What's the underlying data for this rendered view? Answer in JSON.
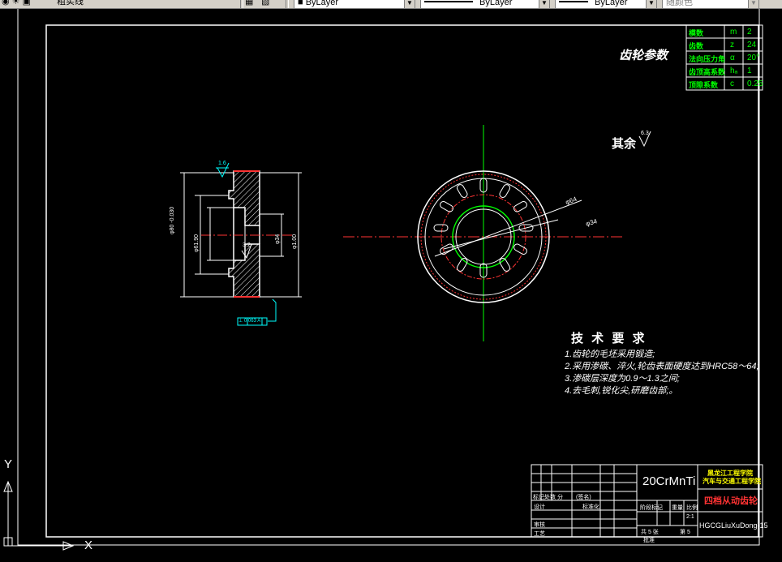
{
  "toolbar": {
    "layer_name": "粗实线",
    "color_value": "ByLayer",
    "linetype_value": "ByLayer",
    "lineweight_value": "ByLayer",
    "plotstyle_value": "随颜色"
  },
  "param_table": {
    "heading": "齿轮参数",
    "rows": [
      {
        "name": "模数",
        "symbol": "m",
        "value": "2"
      },
      {
        "name": "齿数",
        "symbol": "z",
        "value": "24"
      },
      {
        "name": "法向压力角",
        "symbol": "α",
        "value": "20°"
      },
      {
        "name": "齿顶高系数",
        "symbol": "hₐ",
        "value": "1"
      },
      {
        "name": "顶隙系数",
        "symbol": "c",
        "value": "0.25"
      }
    ]
  },
  "roughness_note": {
    "label": "其余",
    "value": "6.3"
  },
  "section_view": {
    "roughness_top": "1.6",
    "roughness_mid": "3.2",
    "dim_outer_left": "φ80 -0.030",
    "dim_inner_left": "φ61.90",
    "dim_bore": "φ34",
    "dim_od": "φ1.00",
    "tolerance_frame": "⊥ 0.063 A"
  },
  "front_view": {
    "dim_64": "φ64",
    "dim_34": "φ34"
  },
  "tech_req": {
    "title": "技 术 要 求",
    "items": [
      "1.齿轮的毛坯采用锻造;",
      "2.采用渗碳、淬火,轮齿表面硬度达到HRC58～64;",
      "3.渗碳层深度为0.9～1.3之间;",
      "4.去毛刺,锐化尖,研磨齿部;。"
    ]
  },
  "title_block": {
    "material": "20CrMnTi",
    "school_line1": "黑龙江工程学院",
    "school_line2": "汽车与交通工程学院",
    "part_name": "四档从动齿轮",
    "drawing_no": "HGCGLiuXuDong-15",
    "scale": "2:1",
    "sheets_total": "共 5 张",
    "sheet_no": "第 5",
    "lbl_mark_zone": "标记处数 分",
    "lbl_signature": "(签名)",
    "lbl_design": "设计",
    "lbl_standard": "标准化",
    "lbl_review": "审核",
    "lbl_process": "工艺",
    "lbl_stage": "阶段标记",
    "lbl_weight": "重量",
    "lbl_scale": "比例",
    "lbl_approve": "批准"
  },
  "ucs": {
    "x": "X",
    "y": "Y"
  }
}
